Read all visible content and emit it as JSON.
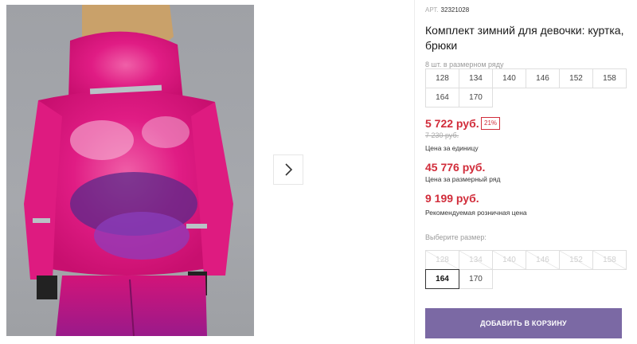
{
  "gallery": {
    "next_icon": "chevron-right-icon"
  },
  "product": {
    "art_label": "АРТ.",
    "art_value": "32321028",
    "title": "Комплект зимний для девочки: куртка, брюки",
    "row_note": "8 шт. в размерном ряду",
    "row_sizes": [
      "128",
      "134",
      "140",
      "146",
      "152",
      "158",
      "164",
      "170"
    ],
    "unit_price": "5 722 руб.",
    "discount": "21%",
    "old_price": "7 230 руб.",
    "unit_price_caption": "Цена за единицу",
    "row_price": "45 776 руб.",
    "row_price_caption": "Цена за размерный ряд",
    "retail_price": "9 199 руб.",
    "retail_price_caption": "Рекомендуемая розничная цена",
    "choose_size_label": "Выберите размер:",
    "size_options": [
      {
        "label": "128",
        "state": "disabled"
      },
      {
        "label": "134",
        "state": "disabled"
      },
      {
        "label": "140",
        "state": "disabled"
      },
      {
        "label": "146",
        "state": "disabled"
      },
      {
        "label": "152",
        "state": "disabled"
      },
      {
        "label": "158",
        "state": "disabled"
      },
      {
        "label": "164",
        "state": "selected"
      },
      {
        "label": "170",
        "state": "available"
      }
    ],
    "add_to_cart": "ДОБАВИТЬ В КОРЗИНУ"
  },
  "colors": {
    "price_red": "#d12c3a",
    "button_purple": "#7b69a4",
    "jacket_pink": "#e8207e"
  }
}
